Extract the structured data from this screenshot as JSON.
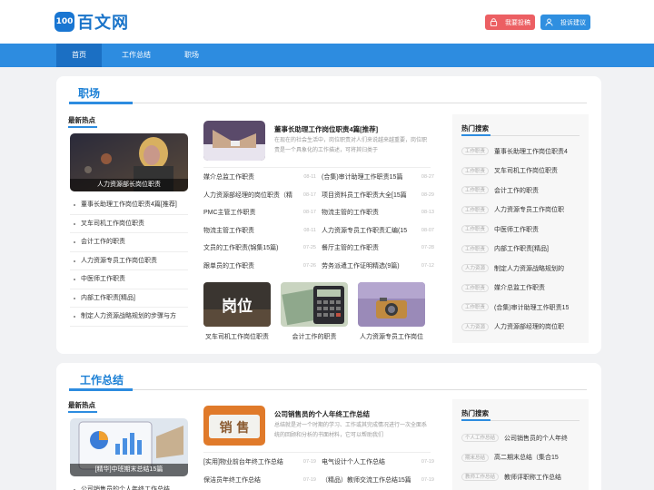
{
  "header": {
    "logo_mark": "100",
    "logo_text": "百文网",
    "report_label": "我要投稿",
    "complain_label": "投诉建议"
  },
  "nav": [
    "首页",
    "工作总结",
    "职场"
  ],
  "section1": {
    "title": "职场",
    "hot_heading": "最新热点",
    "hot_image_caption": "人力资源部长岗位职责",
    "hot_list": [
      "董事长助理工作岗位职责4篇[推荐]",
      "叉车司机工作岗位职责",
      "会计工作的职责",
      "人力资源专员工作岗位职责",
      "中医师工作职责",
      "内部工作职责[精品]",
      "制定人力资源战略规划的步骤与方"
    ],
    "feature": {
      "title": "董事长助理工作岗位职责4篇[推荐]",
      "desc": "在现在的社会生活中，岗位职责对人们来说越来越重要，岗位职责是一个具象化的工作描述，可将其归类于"
    },
    "list_left": [
      {
        "t": "媒介总监工作职责",
        "d": "08-11"
      },
      {
        "t": "人力资源部经理的岗位职责（精",
        "d": "08-17"
      },
      {
        "t": "PMC主管工作职责",
        "d": "08-17"
      },
      {
        "t": "物流主管工作职责",
        "d": "08-11"
      },
      {
        "t": "文员的工作职责(锦集15篇)",
        "d": "07-25"
      },
      {
        "t": "跟单员的工作职责",
        "d": "07-26"
      }
    ],
    "list_right": [
      {
        "t": "(合集)审计助理工作职责15篇",
        "d": "08-27"
      },
      {
        "t": "项目资料员工作职责大全[15篇",
        "d": "08-29"
      },
      {
        "t": "物流主管的工作职责",
        "d": "08-13"
      },
      {
        "t": "人力资源专员工作职责汇编(15",
        "d": "08-07"
      },
      {
        "t": "餐厅主管的工作职责",
        "d": "07-28"
      },
      {
        "t": "劳务派遣工作证明精选(9篇)",
        "d": "07-12"
      }
    ],
    "thumbs": [
      {
        "overlay": "岗位",
        "caption": "叉车司机工作岗位职责"
      },
      {
        "overlay": "",
        "caption": "会计工作的职责"
      },
      {
        "overlay": "",
        "caption": "人力资源专员工作岗位"
      }
    ],
    "side_heading": "热门搜索",
    "side_list": [
      {
        "tag": "工作职责",
        "txt": "董事长助理工作岗位职责4"
      },
      {
        "tag": "工作职责",
        "txt": "叉车司机工作岗位职责"
      },
      {
        "tag": "工作职责",
        "txt": "会计工作的职责"
      },
      {
        "tag": "工作职责",
        "txt": "人力资源专员工作岗位职"
      },
      {
        "tag": "工作职责",
        "txt": "中医师工作职责"
      },
      {
        "tag": "工作职责",
        "txt": "内部工作职责[精品]"
      },
      {
        "tag": "人力资源",
        "txt": "制定人力资源战略规划的"
      },
      {
        "tag": "工作职责",
        "txt": "媒介总监工作职责"
      },
      {
        "tag": "工作职责",
        "txt": "(合集)审计助理工作职责15"
      },
      {
        "tag": "人力资源",
        "txt": "人力资源部经理的岗位职"
      }
    ]
  },
  "section2": {
    "title": "工作总结",
    "hot_heading": "最新热点",
    "hot_image_caption": "[精华]中班期末总结15篇",
    "hot_list_first": "公司销售员的个人年终工作总结",
    "feature": {
      "title": "公司销售员的个人年终工作总结",
      "desc": "总结就是对一个时期的学习、工作或其完成情况进行一次全面系统的回顾和分析的书面材料，它可以帮助我们"
    },
    "feat_overlay": "销 售",
    "list_left": [
      {
        "t": "[实用]物业前台年终工作总结",
        "d": "07-19"
      },
      {
        "t": "保洁员年终工作总结",
        "d": "07-19"
      }
    ],
    "list_right": [
      {
        "t": "电气设计个人工作总结",
        "d": "07-19"
      },
      {
        "t": "（精品）教师交流工作总结15篇",
        "d": "07-19"
      }
    ],
    "side_heading": "热门搜索",
    "side_list": [
      {
        "tag": "个人工作总结",
        "txt": "公司销售员的个人年终"
      },
      {
        "tag": "期末总结",
        "txt": "高二期末总结（集合15"
      },
      {
        "tag": "教师工作总结",
        "txt": "教师评职称工作总结"
      }
    ]
  }
}
